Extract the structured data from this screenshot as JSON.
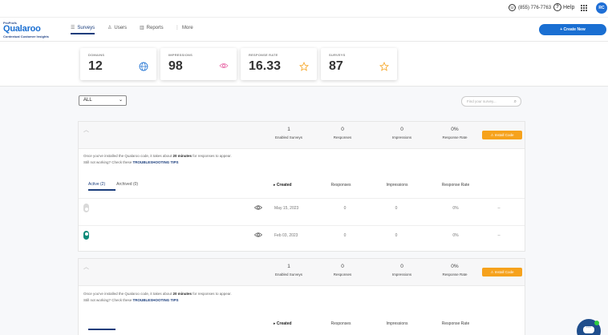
{
  "topbar": {
    "phone": "(855) 776-7763",
    "help": "Help",
    "avatar_initials": "RC"
  },
  "nav": {
    "logo_small": "ProProfs",
    "logo_brand": "Qualaroo",
    "logo_tagline": "Contextual Customer Insights",
    "items": [
      {
        "label": "Surveys",
        "icon": "surveys-icon"
      },
      {
        "label": "Users",
        "icon": "users-icon"
      },
      {
        "label": "Reports",
        "icon": "reports-icon"
      },
      {
        "label": "More",
        "icon": "more-icon"
      }
    ],
    "create_button": "+ Create New"
  },
  "stats": [
    {
      "label": "DOMAINS",
      "value": "12",
      "icon": "globe-icon",
      "color": "#1a6fd2"
    },
    {
      "label": "IMPRESSIONS",
      "value": "98",
      "icon": "eye-icon",
      "color": "#e86aa8"
    },
    {
      "label": "RESPONSE RATE",
      "value": "16.33",
      "icon": "star-icon",
      "color": "#f6a21c"
    },
    {
      "label": "SURVEYS",
      "value": "87",
      "icon": "star-icon",
      "color": "#f6a21c"
    }
  ],
  "filter": {
    "selected": "ALL",
    "search_placeholder": "Find your survey..."
  },
  "cards": [
    {
      "enabled_surveys": "1",
      "enabled_label": "Enabled Surveys",
      "responses": "0",
      "responses_label": "Responses",
      "impressions": "0",
      "impressions_label": "Impressions",
      "rate": "0%",
      "rate_label": "Response Rate",
      "install_button": "Install Code",
      "info_line1_a": "Once you've installed the Qualaroo code, it takes about ",
      "info_line1_b": "20 minutes",
      "info_line1_c": " for responses to appear.",
      "info_line2_a": "Still not working? Check these ",
      "info_line2_link": "TROUBLESHOOTING TIPS",
      "tab_active": "Active (2)",
      "tab_archived": "Archived (0)",
      "columns": {
        "created": "Created",
        "responses": "Responses",
        "impressions": "Impressions",
        "rate": "Response Rate"
      },
      "rows": [
        {
          "enabled": false,
          "created": "May 15, 2023",
          "responses": "0",
          "impressions": "0",
          "rate": "0%",
          "extra": "--"
        },
        {
          "enabled": true,
          "created": "Feb 03, 2023",
          "responses": "0",
          "impressions": "0",
          "rate": "0%",
          "extra": "--"
        }
      ]
    },
    {
      "enabled_surveys": "1",
      "enabled_label": "Enabled Surveys",
      "responses": "0",
      "responses_label": "Responses",
      "impressions": "0",
      "impressions_label": "Impressions",
      "rate": "0%",
      "rate_label": "Response Rate",
      "install_button": "Install Code",
      "info_line1_a": "Once you've installed the Qualaroo code, it takes about ",
      "info_line1_b": "20 minutes",
      "info_line1_c": " for responses to appear.",
      "info_line2_a": "Still not working? Check these ",
      "info_line2_link": "TROUBLESHOOTING TIPS",
      "columns": {
        "created": "Created",
        "responses": "Responses",
        "impressions": "Impressions",
        "rate": "Response Rate"
      }
    }
  ]
}
